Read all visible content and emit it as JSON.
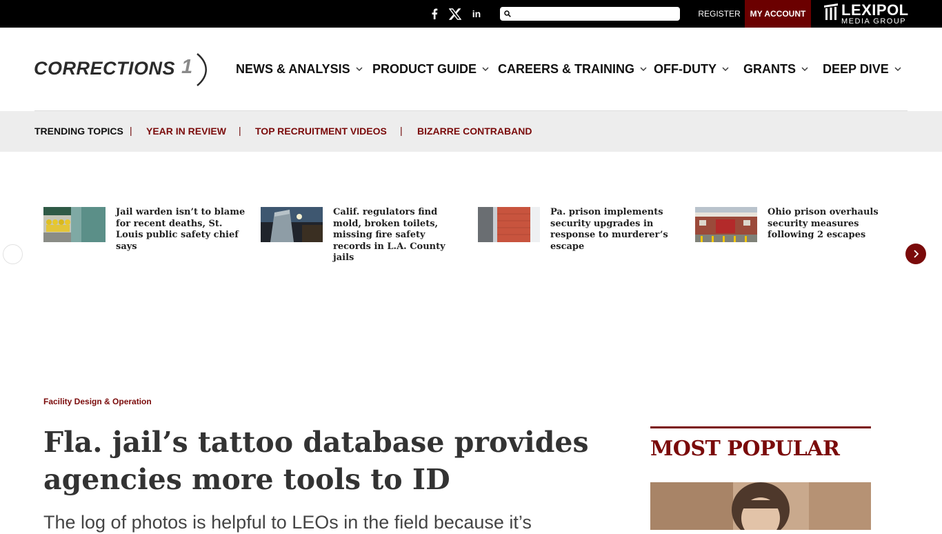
{
  "topbar": {
    "social": [
      {
        "name": "facebook",
        "icon": "facebook-icon",
        "glyph": "f"
      },
      {
        "name": "x",
        "icon": "x-icon",
        "glyph": "𝕏"
      },
      {
        "name": "linkedin",
        "icon": "linkedin-icon",
        "glyph": "in"
      }
    ],
    "search": {
      "placeholder": "",
      "value": ""
    },
    "register_label": "REGISTER",
    "my_account_label": "MY ACCOUNT",
    "brand": {
      "name": "LEXIPOL",
      "sub": "MEDIA GROUP"
    }
  },
  "header": {
    "logo_text": "CORRECTIONS",
    "logo_number": "1",
    "nav": [
      {
        "label": "NEWS & ANALYSIS"
      },
      {
        "label": "PRODUCT GUIDE"
      },
      {
        "label": "CAREERS & TRAINING"
      },
      {
        "label": "OFF-DUTY"
      },
      {
        "label": "GRANTS"
      },
      {
        "label": "DEEP DIVE"
      }
    ]
  },
  "trending": {
    "label": "TRENDING TOPICS",
    "separator": "|",
    "links": [
      {
        "label": "YEAR IN REVIEW"
      },
      {
        "label": "TOP RECRUITMENT VIDEOS"
      },
      {
        "label": "BIZARRE CONTRABAND"
      }
    ]
  },
  "carousel": {
    "items": [
      {
        "headline": "Jail warden isn’t to blame for recent deaths, St. Louis public safety chief says"
      },
      {
        "headline": "Calif. regulators find mold, broken toilets, missing fire safety records in L.A. County jails"
      },
      {
        "headline": "Pa. prison implements security upgrades in response to murderer’s escape"
      },
      {
        "headline": "Ohio prison overhauls security measures following 2 escapes"
      }
    ]
  },
  "article": {
    "category": "Facility Design & Operation",
    "title": "Fla. jail’s tattoo database provides agencies more tools to ID",
    "dek": "The log of photos is helpful to LEOs in the field because it’s"
  },
  "sidebar": {
    "most_popular_title": "MOST POPULAR"
  },
  "colors": {
    "topbar_bg": "#000000",
    "brand_maroon": "#7a0a0a",
    "my_account_bg": "#6b0000",
    "trending_bg": "#ededed"
  }
}
